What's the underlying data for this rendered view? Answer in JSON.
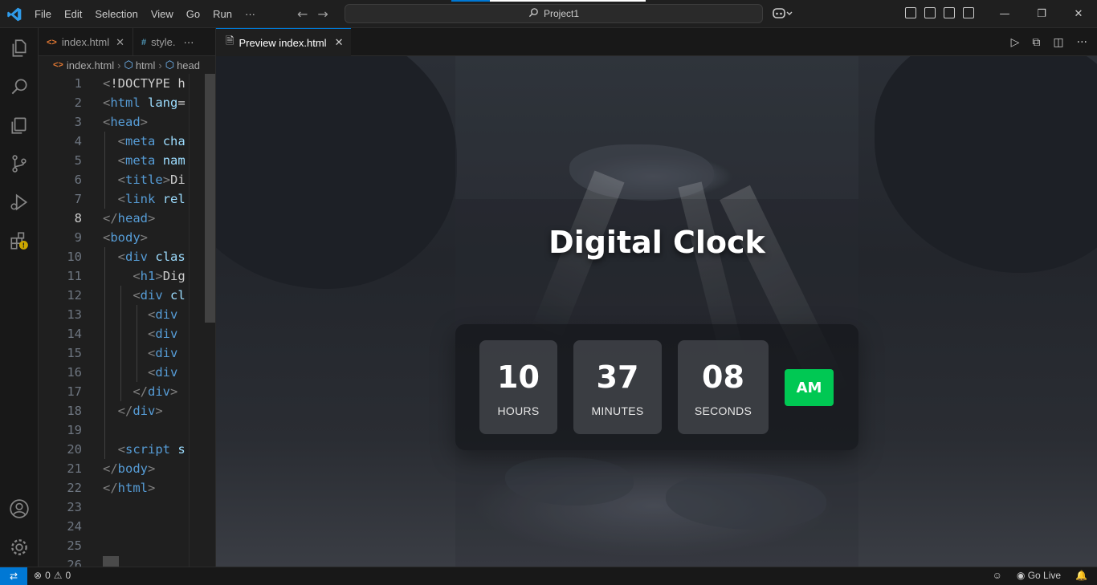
{
  "titlebar": {
    "menu": [
      "File",
      "Edit",
      "Selection",
      "View",
      "Go",
      "Run",
      "···"
    ],
    "search_text": "Project1"
  },
  "left_editor": {
    "tabs": [
      {
        "label": "index.html",
        "icon": "html-icon"
      },
      {
        "label": "style.",
        "icon": "css-icon"
      }
    ],
    "more": "···",
    "breadcrumb": [
      "index.html",
      "html",
      "head"
    ],
    "active_line": 8,
    "lines": [
      {
        "n": 1,
        "code": "<!DOCTYPE h"
      },
      {
        "n": 2,
        "code": "<html lang="
      },
      {
        "n": 3,
        "code": "<head>"
      },
      {
        "n": 4,
        "code": "  <meta cha"
      },
      {
        "n": 5,
        "code": "  <meta nam"
      },
      {
        "n": 6,
        "code": "  <title>Di"
      },
      {
        "n": 7,
        "code": "  <link rel"
      },
      {
        "n": 8,
        "code": "</head>"
      },
      {
        "n": 9,
        "code": "<body>"
      },
      {
        "n": 10,
        "code": "  <div clas"
      },
      {
        "n": 11,
        "code": "    <h1>Dig"
      },
      {
        "n": 12,
        "code": "    <div cl"
      },
      {
        "n": 13,
        "code": "      <div "
      },
      {
        "n": 14,
        "code": "      <div "
      },
      {
        "n": 15,
        "code": "      <div "
      },
      {
        "n": 16,
        "code": "      <div "
      },
      {
        "n": 17,
        "code": "    </div>"
      },
      {
        "n": 18,
        "code": "  </div>"
      },
      {
        "n": 19,
        "code": ""
      },
      {
        "n": 20,
        "code": "  <script s"
      },
      {
        "n": 21,
        "code": "</body>"
      },
      {
        "n": 22,
        "code": "</html>"
      },
      {
        "n": 23,
        "code": ""
      },
      {
        "n": 24,
        "code": ""
      },
      {
        "n": 25,
        "code": ""
      },
      {
        "n": 26,
        "code": ""
      }
    ]
  },
  "preview": {
    "tab_label": "Preview index.html",
    "title": "Digital Clock",
    "hours": "10",
    "hours_label": "HOURS",
    "minutes": "37",
    "minutes_label": "MINUTES",
    "seconds": "08",
    "seconds_label": "SECONDS",
    "period": "AM",
    "period_color": "#00c853"
  },
  "statusbar": {
    "errors": "0",
    "warnings": "0",
    "go_live": "Go Live"
  },
  "colors": {
    "accent": "#0078d4",
    "tag": "#569cd6",
    "attr": "#9cdcfe"
  }
}
